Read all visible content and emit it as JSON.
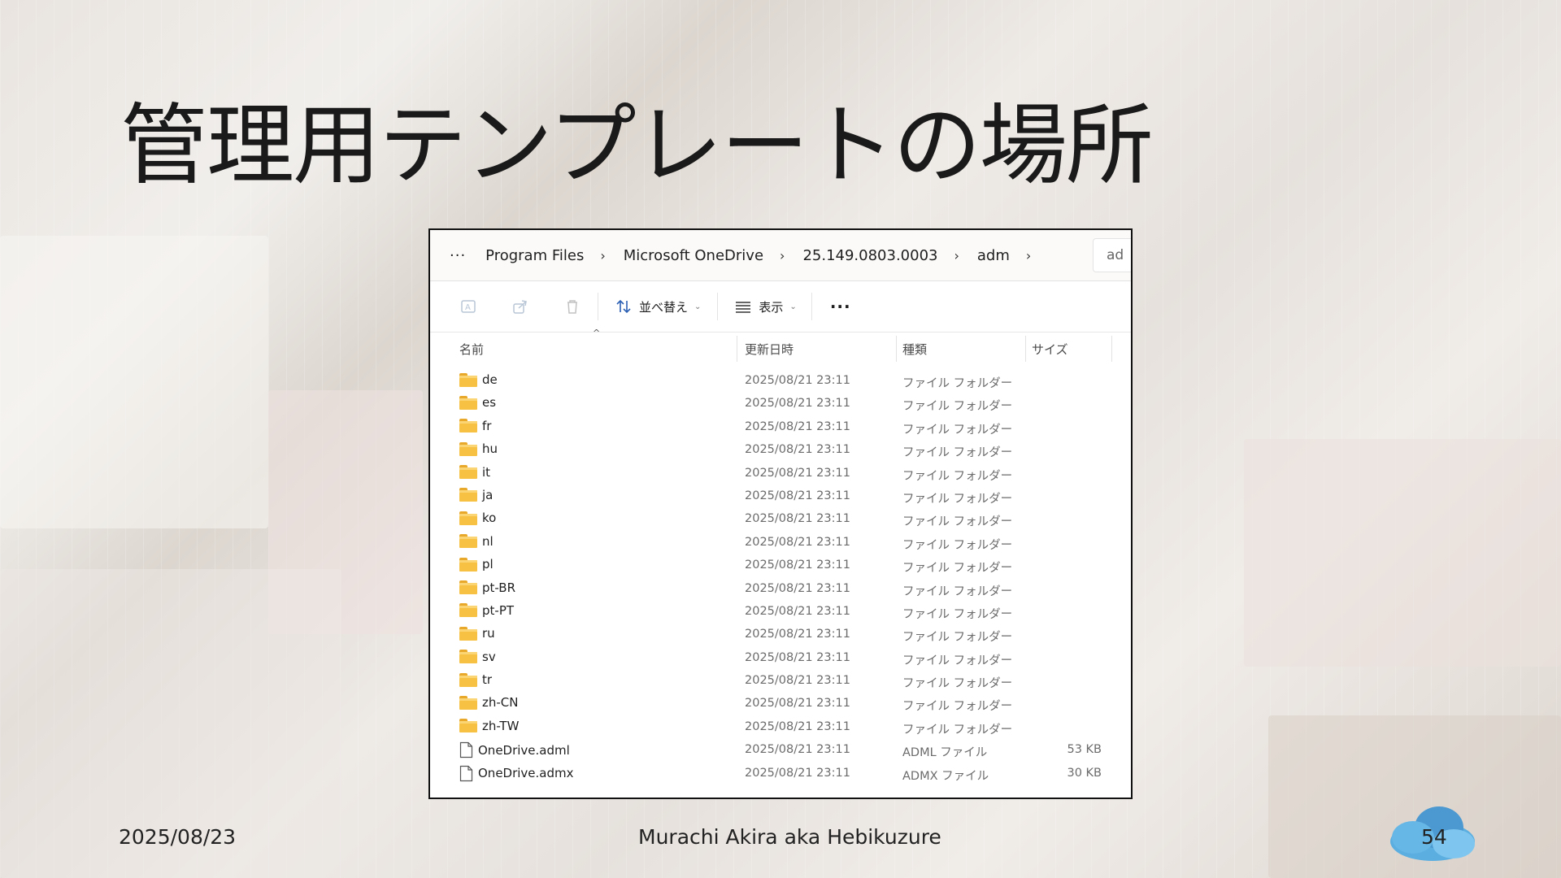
{
  "slide": {
    "title": "管理用テンプレートの場所",
    "footer_date": "2025/08/23",
    "footer_author": "Murachi Akira aka Hebikuzure",
    "page_number": "54"
  },
  "explorer": {
    "breadcrumb": {
      "overflow": "···",
      "items": [
        "Program Files",
        "Microsoft OneDrive",
        "25.149.0803.0003",
        "adm"
      ],
      "separator": "›",
      "search_stub": "ad"
    },
    "toolbar": {
      "sort_label": "並べ替え",
      "view_label": "表示",
      "more_label": "···"
    },
    "columns": {
      "name": "名前",
      "modified": "更新日時",
      "type": "種類",
      "size": "サイズ"
    },
    "items": [
      {
        "name": "de",
        "modified": "2025/08/21 23:11",
        "type": "ファイル フォルダー",
        "size": "",
        "kind": "folder"
      },
      {
        "name": "es",
        "modified": "2025/08/21 23:11",
        "type": "ファイル フォルダー",
        "size": "",
        "kind": "folder"
      },
      {
        "name": "fr",
        "modified": "2025/08/21 23:11",
        "type": "ファイル フォルダー",
        "size": "",
        "kind": "folder"
      },
      {
        "name": "hu",
        "modified": "2025/08/21 23:11",
        "type": "ファイル フォルダー",
        "size": "",
        "kind": "folder"
      },
      {
        "name": "it",
        "modified": "2025/08/21 23:11",
        "type": "ファイル フォルダー",
        "size": "",
        "kind": "folder"
      },
      {
        "name": "ja",
        "modified": "2025/08/21 23:11",
        "type": "ファイル フォルダー",
        "size": "",
        "kind": "folder"
      },
      {
        "name": "ko",
        "modified": "2025/08/21 23:11",
        "type": "ファイル フォルダー",
        "size": "",
        "kind": "folder"
      },
      {
        "name": "nl",
        "modified": "2025/08/21 23:11",
        "type": "ファイル フォルダー",
        "size": "",
        "kind": "folder"
      },
      {
        "name": "pl",
        "modified": "2025/08/21 23:11",
        "type": "ファイル フォルダー",
        "size": "",
        "kind": "folder"
      },
      {
        "name": "pt-BR",
        "modified": "2025/08/21 23:11",
        "type": "ファイル フォルダー",
        "size": "",
        "kind": "folder"
      },
      {
        "name": "pt-PT",
        "modified": "2025/08/21 23:11",
        "type": "ファイル フォルダー",
        "size": "",
        "kind": "folder"
      },
      {
        "name": "ru",
        "modified": "2025/08/21 23:11",
        "type": "ファイル フォルダー",
        "size": "",
        "kind": "folder"
      },
      {
        "name": "sv",
        "modified": "2025/08/21 23:11",
        "type": "ファイル フォルダー",
        "size": "",
        "kind": "folder"
      },
      {
        "name": "tr",
        "modified": "2025/08/21 23:11",
        "type": "ファイル フォルダー",
        "size": "",
        "kind": "folder"
      },
      {
        "name": "zh-CN",
        "modified": "2025/08/21 23:11",
        "type": "ファイル フォルダー",
        "size": "",
        "kind": "folder"
      },
      {
        "name": "zh-TW",
        "modified": "2025/08/21 23:11",
        "type": "ファイル フォルダー",
        "size": "",
        "kind": "folder"
      },
      {
        "name": "OneDrive.adml",
        "modified": "2025/08/21 23:11",
        "type": "ADML ファイル",
        "size": "53 KB",
        "kind": "file"
      },
      {
        "name": "OneDrive.admx",
        "modified": "2025/08/21 23:11",
        "type": "ADMX ファイル",
        "size": "30 KB",
        "kind": "file"
      }
    ]
  },
  "icons": {
    "rename": "rename-icon",
    "share": "share-icon",
    "delete": "trash-icon",
    "sort": "sort-icon",
    "view": "view-list-icon",
    "folder": "folder-icon",
    "file": "file-icon",
    "cloud": "cloud-icon"
  },
  "colors": {
    "folder_yellow": "#f7c143",
    "cloud_blue": "#5aaee0"
  }
}
